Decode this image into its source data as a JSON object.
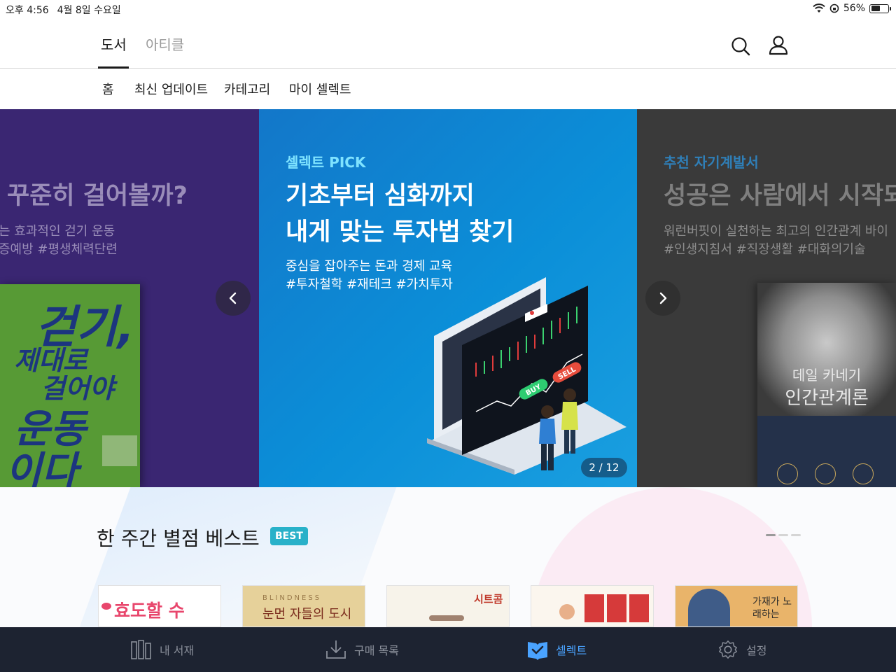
{
  "status_bar": {
    "time": "오후 4:56",
    "date": "4월 8일 수요일",
    "battery_text": "56%",
    "battery_level": 0.56
  },
  "top_nav": {
    "tabs": [
      {
        "label": "도서",
        "active": true
      },
      {
        "label": "아티클",
        "active": false
      }
    ],
    "icons": [
      "search-icon",
      "profile-icon"
    ]
  },
  "sub_nav": {
    "items": [
      "홈",
      "최신 업데이트",
      "카테고리",
      "마이 셀렉트"
    ]
  },
  "carousel": {
    "left_slide": {
      "title": "꾸준히 걸어볼까?",
      "desc_line1": "는 효과적인 걷기 운동",
      "desc_line2": "증예방 #평생체력단련",
      "book": {
        "line1": "걷기,",
        "line2": "제대로",
        "line3": "걸어야",
        "line4": "운동",
        "line5": "이다"
      }
    },
    "center_slide": {
      "label": "셀렉트 PICK",
      "title_line1": "기초부터 심화까지",
      "title_line2": "내게 맞는 투자법 찾기",
      "desc_line1": "중심을 잡아주는 돈과 경제 교육",
      "desc_line2": "#투자철학 #재테크 #가치투자",
      "illustration": {
        "buy_label": "BUY",
        "sell_label": "SELL"
      }
    },
    "right_slide": {
      "label": "추천 자기계발서",
      "title": "성공은 사람에서 시작되",
      "desc_line1": "워런버핏이 실천하는 최고의 인간관계 바이",
      "desc_line2": "#인생지침서 #직장생활 #대화의기술",
      "book": {
        "author": "데일 카네기",
        "title": "인간관계론"
      }
    },
    "page_indicator": "2 / 12",
    "colors": {
      "left": "#3f2a7c",
      "center": "#0b8fd8",
      "right": "#3a3a3a",
      "accent_label": "#7fe3ff"
    }
  },
  "best_section": {
    "title": "한 주간 별점 베스트",
    "badge": "BEST",
    "books": [
      {
        "title": "효도할 수",
        "bg": "#ffffff",
        "color": "#e8466c"
      },
      {
        "title": "눈먼 자들의 도시",
        "bg": "#e6d19a",
        "color": "#7a2b1c"
      },
      {
        "title": "시트콤",
        "bg": "#f7f3ea",
        "color": "#c0392b"
      },
      {
        "title": "",
        "bg": "#fbf6ee",
        "color": "#c0392b"
      },
      {
        "title": "가재가 노래하는",
        "bg": "#e9b46a",
        "color": "#2a2a2a"
      }
    ],
    "carousel_pages": 3,
    "current_page": 1
  },
  "tab_bar": {
    "items": [
      {
        "label": "내 서재",
        "icon": "bookshelf-icon",
        "active": false
      },
      {
        "label": "구매 목록",
        "icon": "download-icon",
        "active": false
      },
      {
        "label": "셀렉트",
        "icon": "select-book-icon",
        "active": true
      },
      {
        "label": "설정",
        "icon": "gear-icon",
        "active": false
      }
    ]
  }
}
